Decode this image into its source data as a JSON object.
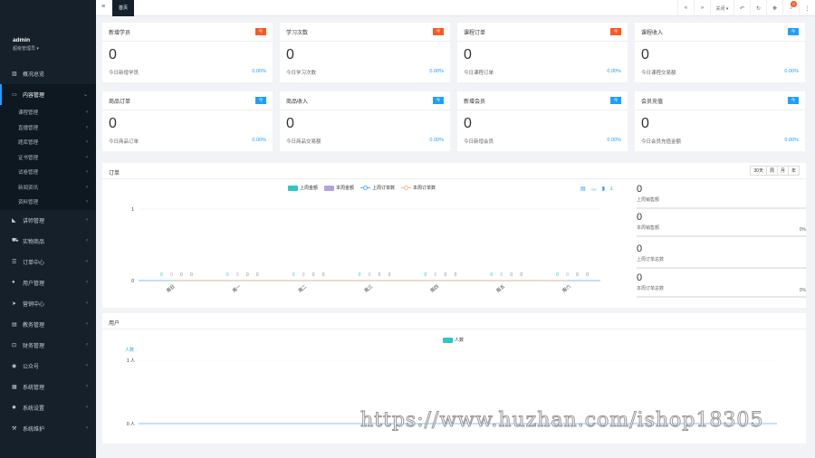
{
  "colors": {
    "sidebar": "#15202b",
    "accent": "#1e9fff",
    "orange": "#ff5722",
    "teal": "#2ec7c9",
    "purple": "#b6a2de",
    "blue": "#5ab1ef",
    "amber": "#ffb980"
  },
  "user": {
    "name": "admin",
    "role": "超级管理员 ▾"
  },
  "menu": {
    "overview": "概况总览",
    "content": "内容管理",
    "content_sub": [
      "课程管理",
      "直播管理",
      "题库管理",
      "证书管理",
      "试卷管理",
      "新闻资讯",
      "资料管理"
    ],
    "rest": [
      "讲师管理",
      "实物商品",
      "订单中心",
      "用户管理",
      "营销中心",
      "教务管理",
      "财务管理",
      "公众号",
      "系统管理",
      "系统设置",
      "系统维护"
    ]
  },
  "topbar": {
    "tab": "首页",
    "close_label": "关闭 ▾",
    "badge": "0"
  },
  "cards": [
    {
      "title": "新增学员",
      "tag": "今",
      "tag_color": "orange",
      "value": "0",
      "label": "今日新增学员",
      "pct": "0.00%"
    },
    {
      "title": "学习次数",
      "tag": "今",
      "tag_color": "orange",
      "value": "0",
      "label": "今日学习次数",
      "pct": "0.00%"
    },
    {
      "title": "课程订单",
      "tag": "今",
      "tag_color": "orange",
      "value": "0",
      "label": "今日课程订单",
      "pct": "0.00%"
    },
    {
      "title": "课程收入",
      "tag": "今",
      "tag_color": "blue",
      "value": "0",
      "label": "今日课程交易额",
      "pct": "0.00%"
    },
    {
      "title": "商品订单",
      "tag": "今",
      "tag_color": "blue",
      "value": "0",
      "label": "今日商品订单",
      "pct": "0.00%"
    },
    {
      "title": "商品收入",
      "tag": "今",
      "tag_color": "blue",
      "value": "0",
      "label": "今日商品交易额",
      "pct": "0.00%"
    },
    {
      "title": "新增会员",
      "tag": "今",
      "tag_color": "blue",
      "value": "0",
      "label": "今日新增会员",
      "pct": "0.00%"
    },
    {
      "title": "会员充值",
      "tag": "今",
      "tag_color": "blue",
      "value": "0",
      "label": "今日会员充值金额",
      "pct": "0.00%"
    }
  ],
  "order_panel": {
    "title": "订单",
    "ranges": [
      "30天",
      "周",
      "月",
      "年"
    ],
    "stats": [
      {
        "value": "0",
        "label": "上周销售额",
        "pct": ""
      },
      {
        "value": "0",
        "label": "本周销售额",
        "pct": "0%"
      },
      {
        "value": "0",
        "label": "上周订单总数",
        "pct": ""
      },
      {
        "value": "0",
        "label": "本周订单总数",
        "pct": "0%"
      }
    ]
  },
  "user_panel": {
    "title": "用户"
  },
  "chart_data": [
    {
      "type": "bar",
      "categories": [
        "周日",
        "周一",
        "周二",
        "周三",
        "周四",
        "周五",
        "周六"
      ],
      "ylim": [
        0,
        1
      ],
      "yticks": [
        "0",
        "1"
      ],
      "series": [
        {
          "name": "上周金额",
          "values": [
            0,
            0,
            0,
            0,
            0,
            0,
            0
          ]
        },
        {
          "name": "本周金额",
          "values": [
            0,
            0,
            0,
            0,
            0,
            0,
            0
          ]
        },
        {
          "name": "上周订单数",
          "values": [
            0,
            0,
            0,
            0,
            0,
            0,
            0
          ]
        },
        {
          "name": "本周订单数",
          "values": [
            0,
            0,
            0,
            0,
            0,
            0,
            0
          ]
        }
      ],
      "legend": "top-center"
    },
    {
      "type": "line",
      "ylabel": "人数",
      "yticks": [
        "0 人",
        "1 人"
      ],
      "ylim": [
        0,
        1
      ],
      "series": [
        {
          "name": "人数",
          "values": [
            0
          ]
        }
      ],
      "legend": "top-center"
    }
  ],
  "watermark": "https://www.huzhan.com/ishop18305"
}
